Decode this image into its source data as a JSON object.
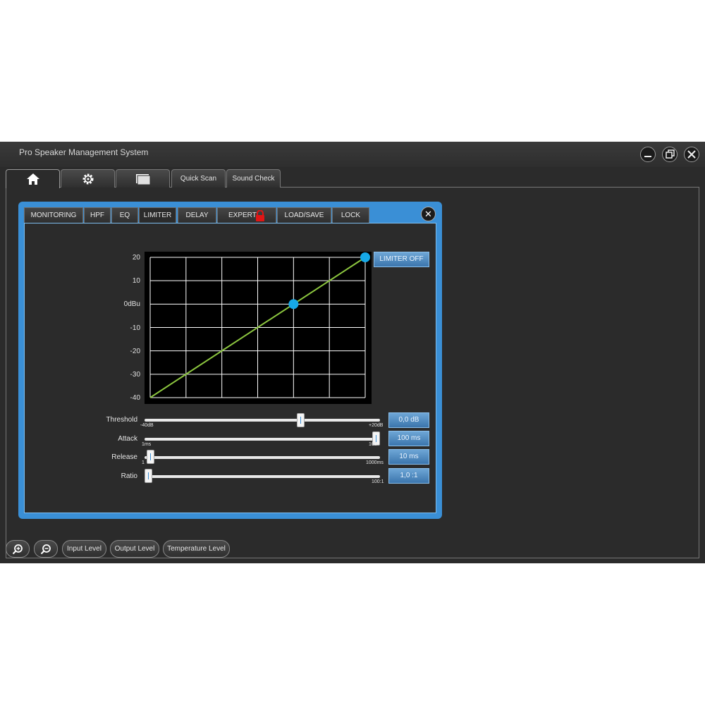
{
  "window": {
    "title": "Pro Speaker Management System"
  },
  "window_controls": [
    "minimize-icon",
    "restore-icon",
    "close-icon"
  ],
  "top_tabs": [
    {
      "icon": "home-icon",
      "label": ""
    },
    {
      "icon": "gear-icon",
      "label": ""
    },
    {
      "icon": "window-icon",
      "label": ""
    },
    {
      "label": "Quick Scan"
    },
    {
      "label": "Sound Check"
    }
  ],
  "panel": {
    "tabs": [
      "MONITORING",
      "HPF",
      "EQ",
      "LIMITER",
      "DELAY",
      "EXPERT",
      "LOAD/SAVE",
      "LOCK"
    ],
    "active_tab": "LIMITER",
    "expert_badge": "lock-icon",
    "limiter_button": "LIMITER OFF"
  },
  "chart_data": {
    "type": "line",
    "y_tick_labels": [
      "20",
      "10",
      "0dBu",
      "-10",
      "-20",
      "-30",
      "-40"
    ],
    "ylim": [
      -40,
      20
    ],
    "xlim": [
      -40,
      20
    ],
    "grid": true,
    "series": [
      {
        "x": [
          -40,
          20
        ],
        "y": [
          -40,
          20
        ]
      }
    ],
    "threshold_point": [
      0,
      0
    ],
    "line_color": "#8cc63f",
    "point_color": "#16a9e8"
  },
  "sliders": [
    {
      "label": "Threshold",
      "min_label": "-40dB",
      "max_label": "+20dB",
      "value": "0,0 dB",
      "fraction": 0.67
    },
    {
      "label": "Attack",
      "min_label": "1ms",
      "max_label": "100",
      "value": "100 ms",
      "fraction": 1.0
    },
    {
      "label": "Release",
      "min_label": "1",
      "max_label": "1000ms",
      "value": "10 ms",
      "fraction": 0.01
    },
    {
      "label": "Ratio",
      "min_label": "",
      "max_label": "100:1",
      "value": "1,0 :1",
      "fraction": 0.0
    }
  ],
  "bottom_bar": {
    "zoom_in_icon": "zoom-in-icon",
    "zoom_out_icon": "zoom-out-icon",
    "buttons": [
      "Input Level",
      "Output Level",
      "Temperature Level"
    ]
  },
  "colors": {
    "accent": "#3a8fd6",
    "background": "#2b2b2b"
  }
}
